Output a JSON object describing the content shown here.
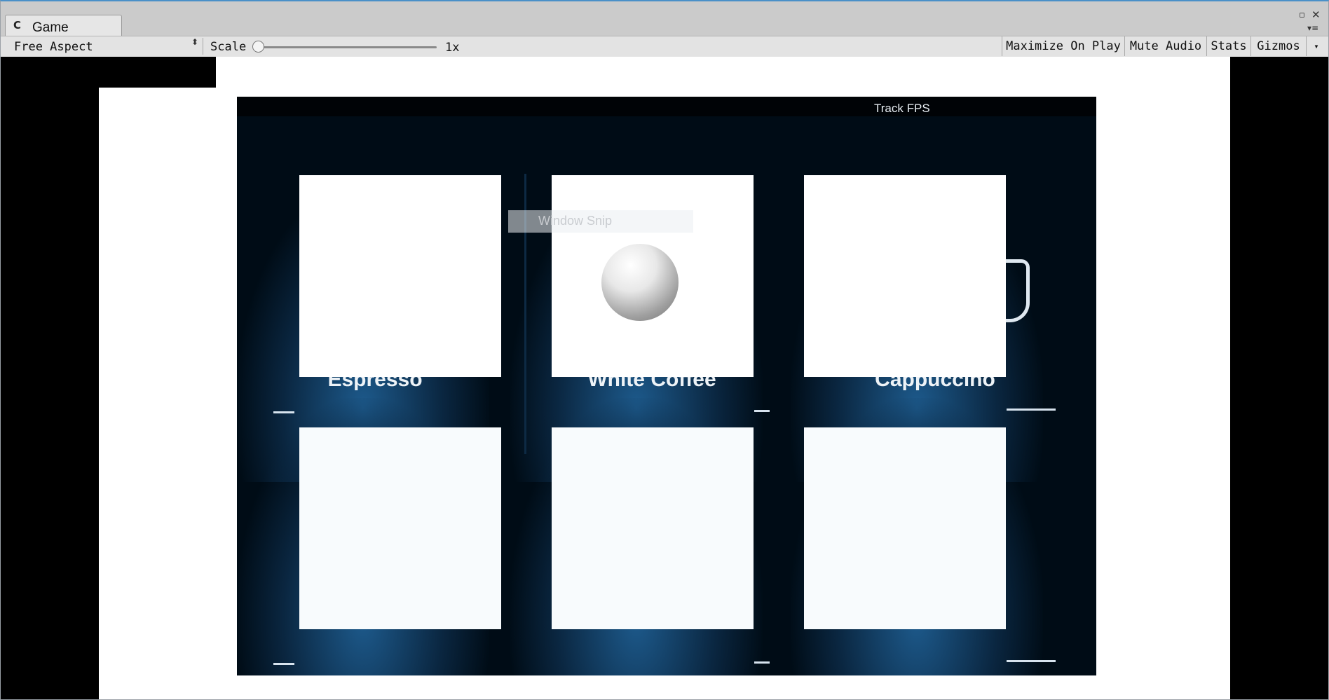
{
  "window": {
    "tab_icon": "C",
    "tab_label": "Game",
    "maximize_glyph": "▫",
    "close_glyph": "✕",
    "menu_glyph": "▾≡"
  },
  "toolbar": {
    "aspect_label": "Free Aspect",
    "aspect_arrow": "⬍",
    "scale_label": "Scale",
    "scale_value": "1x",
    "scale_level": 0,
    "maximize_on_play": "Maximize On Play",
    "mute_audio": "Mute Audio",
    "stats": "Stats",
    "gizmos": "Gizmos",
    "gizmos_arrow": "▾"
  },
  "game": {
    "fps_label": "Track FPS",
    "snip_label": "Window Snip",
    "drinks": [
      {
        "label": "Espresso"
      },
      {
        "label": "White Coffee"
      },
      {
        "label": "Cappuccino"
      },
      {
        "label": ""
      },
      {
        "label": ""
      },
      {
        "label": ""
      }
    ]
  },
  "colors": {
    "editor_bg": "#cbcbcb",
    "toolbar_bg": "#e3e3e3",
    "game_bg": "#000c16",
    "glow": "#1d5a8c"
  },
  "icons": [
    "unity-logo-icon",
    "maximize-icon",
    "close-icon",
    "menu-icon",
    "dropdown-icon"
  ]
}
